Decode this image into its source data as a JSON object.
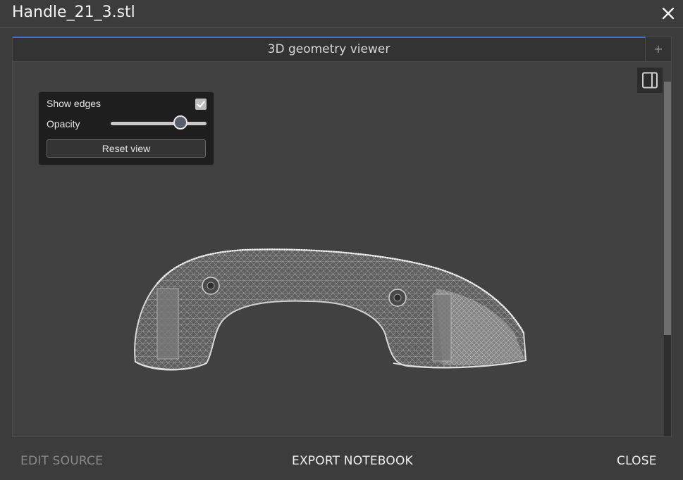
{
  "window": {
    "title": "Handle_21_3.stl",
    "close_icon": "close-icon"
  },
  "tabs": [
    {
      "label": "3D geometry viewer",
      "active": true
    }
  ],
  "tab_add": {
    "label": "+"
  },
  "viewer": {
    "panel_toggle_icon": "sidebar-panel-icon",
    "controls": {
      "show_edges_label": "Show edges",
      "show_edges_checked": true,
      "opacity_label": "Opacity",
      "opacity_value": 0.73,
      "reset_label": "Reset view"
    },
    "model_icon": "handle-wireframe-mesh",
    "accent_color": "#3f6fd8"
  },
  "footer": {
    "edit_source": "EDIT SOURCE",
    "export_notebook": "EXPORT NOTEBOOK",
    "close": "CLOSE"
  }
}
